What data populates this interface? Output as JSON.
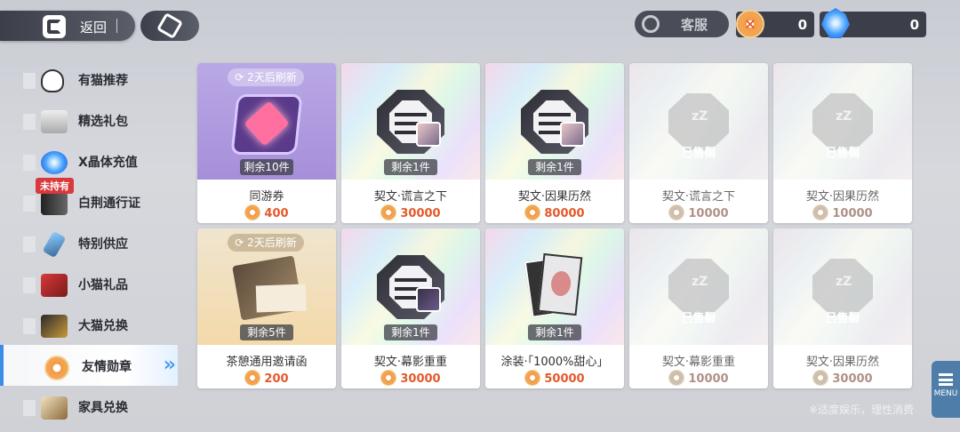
{
  "header": {
    "back_label": "返回",
    "customer_service_label": "客服",
    "currency_friendship": "0",
    "currency_crystal": "0"
  },
  "sidebar": {
    "items": [
      {
        "label": "有猫推荐",
        "icon": "cat-icon"
      },
      {
        "label": "精选礼包",
        "icon": "gift-pack-icon"
      },
      {
        "label": "X晶体充值",
        "icon": "crystal-icon"
      },
      {
        "label": "白荆通行证",
        "icon": "pass-card-icon",
        "badge": "未持有"
      },
      {
        "label": "特别供应",
        "icon": "special-supply-icon"
      },
      {
        "label": "小猫礼品",
        "icon": "small-gift-icon"
      },
      {
        "label": "大猫兑换",
        "icon": "big-exchange-icon"
      },
      {
        "label": "友情勋章",
        "icon": "friendship-medal-icon",
        "active": true
      },
      {
        "label": "家具兑换",
        "icon": "furniture-icon"
      }
    ]
  },
  "cards": [
    {
      "name": "同游券",
      "price": "400",
      "remain": "剩余10件",
      "refresh": "2天后刷新",
      "sold": false
    },
    {
      "name": "契文·谎言之下",
      "price": "30000",
      "remain": "剩余1件",
      "sold": false
    },
    {
      "name": "契文·因果历然",
      "price": "80000",
      "remain": "剩余1件",
      "sold": false
    },
    {
      "name": "契文·谎言之下",
      "price": "10000",
      "sold_label": "已售罄",
      "sold": true
    },
    {
      "name": "契文·因果历然",
      "price": "10000",
      "sold_label": "已售罄",
      "sold": true
    },
    {
      "name": "茶憩通用邀请函",
      "price": "200",
      "remain": "剩余5件",
      "refresh": "2天后刷新",
      "sold": false
    },
    {
      "name": "契文·幕影重重",
      "price": "30000",
      "remain": "剩余1件",
      "sold": false
    },
    {
      "name": "涂装·「1000%甜心」",
      "price": "50000",
      "remain": "剩余1件",
      "sold": false
    },
    {
      "name": "契文·幕影重重",
      "price": "10000",
      "sold_label": "已售罄",
      "sold": true
    },
    {
      "name": "契文·因果历然",
      "price": "30000",
      "sold_label": "已售罄",
      "sold": true
    }
  ],
  "menu_label": "MENU",
  "notice": "※适度娱乐，理性消费"
}
